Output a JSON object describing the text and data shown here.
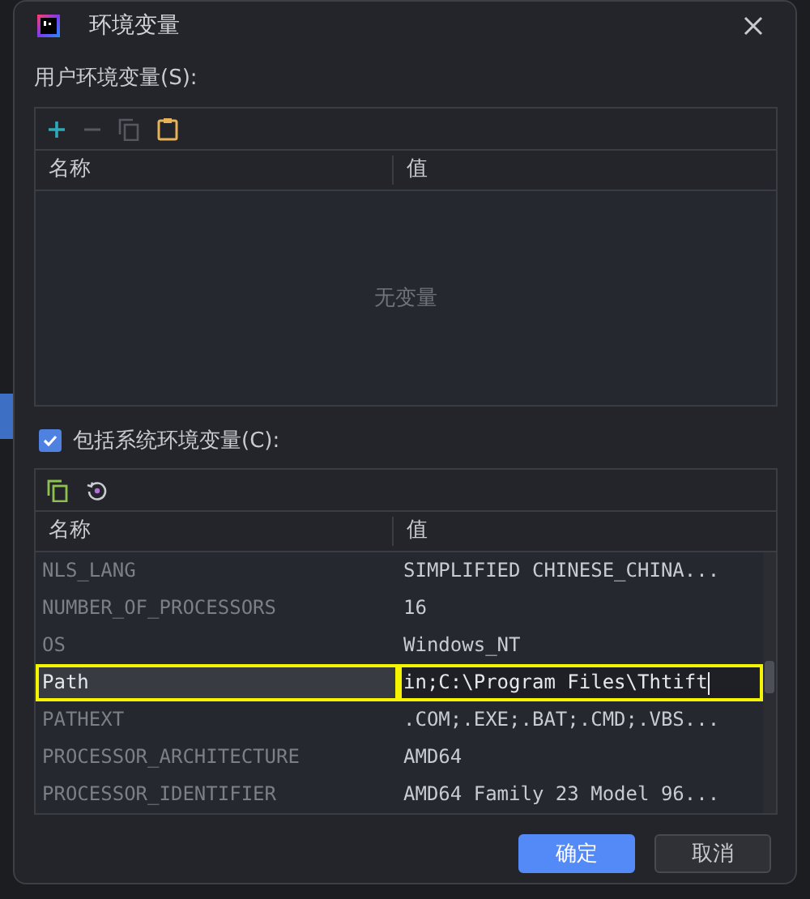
{
  "window": {
    "title": "环境变量"
  },
  "user_vars": {
    "label": "用户环境变量(S):",
    "columns": [
      "名称",
      "值"
    ],
    "empty_text": "无变量"
  },
  "include_system": {
    "label": "包括系统环境变量(C):",
    "checked": true
  },
  "system_vars": {
    "columns": [
      "名称",
      "值"
    ],
    "rows": [
      {
        "name": "NLS_LANG",
        "value": "SIMPLIFIED CHINESE_CHINA...",
        "selected": false,
        "editing": false,
        "annotated": false
      },
      {
        "name": "NUMBER_OF_PROCESSORS",
        "value": "16",
        "selected": false,
        "editing": false,
        "annotated": false
      },
      {
        "name": "OS",
        "value": "Windows_NT",
        "selected": false,
        "editing": false,
        "annotated": false
      },
      {
        "name": "Path",
        "value": "in;C:\\Program Files\\Thtift",
        "selected": true,
        "editing": true,
        "annotated": true
      },
      {
        "name": "PATHEXT",
        "value": ".COM;.EXE;.BAT;.CMD;.VBS...",
        "selected": false,
        "editing": false,
        "annotated": false
      },
      {
        "name": "PROCESSOR_ARCHITECTURE",
        "value": "AMD64",
        "selected": false,
        "editing": false,
        "annotated": false
      },
      {
        "name": "PROCESSOR_IDENTIFIER",
        "value": "AMD64 Family 23 Model 96...",
        "selected": false,
        "editing": false,
        "annotated": false
      }
    ]
  },
  "buttons": [
    {
      "label": "确定",
      "primary": true
    },
    {
      "label": "取消",
      "primary": false
    }
  ]
}
